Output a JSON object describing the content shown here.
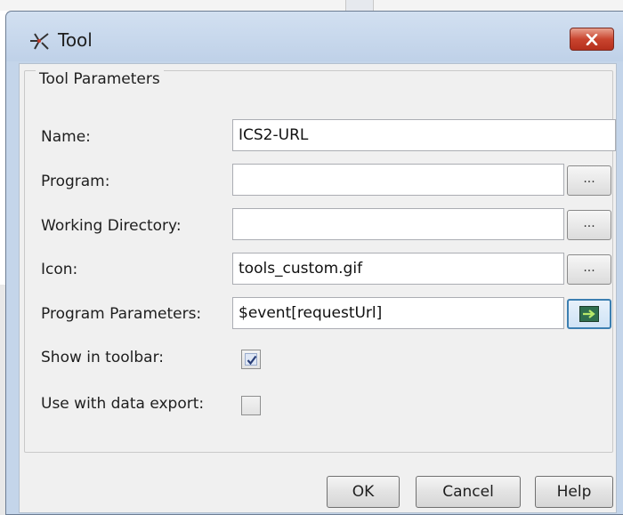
{
  "window": {
    "title": "Tool",
    "close_icon": "close-x"
  },
  "group": {
    "title": "Tool Parameters"
  },
  "fields": {
    "name": {
      "label": "Name:",
      "value": "ICS2-URL"
    },
    "program": {
      "label": "Program:",
      "value": "",
      "button": "..."
    },
    "working_directory": {
      "label": "Working Directory:",
      "value": "",
      "button": "..."
    },
    "icon": {
      "label": "Icon:",
      "value": "tools_custom.gif",
      "button": "..."
    },
    "program_parameters": {
      "label": "Program Parameters:",
      "value": "$event[requestUrl]"
    }
  },
  "checkboxes": {
    "show_in_toolbar": {
      "label": "Show in toolbar:",
      "checked": true
    },
    "use_with_data_export": {
      "label": "Use with data export:",
      "checked": false
    }
  },
  "buttons": {
    "ok": "OK",
    "cancel": "Cancel",
    "help": "Help"
  },
  "colors": {
    "title_bar": "#c4d5ea",
    "close_button": "#c9452f",
    "panel": "#f0f0f0"
  }
}
